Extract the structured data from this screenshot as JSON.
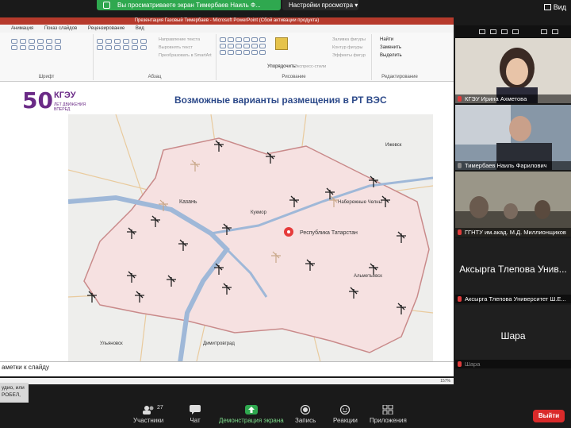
{
  "zoom": {
    "share_banner": "Вы просматриваете экран Тимербаев Наиль Ф...",
    "view_settings": "Настройки просмотра",
    "view_button": "Вид"
  },
  "ppt": {
    "window_title": "Презентация Газовый Тимербаев  -  Microsoft PowerPoint (Сбой активации продукта)",
    "tabs": [
      "Анимация",
      "Показ слайдов",
      "Рецензирование",
      "Вид"
    ],
    "ribbon": {
      "group_font": "Шрифт",
      "group_paragraph": "Абзац",
      "group_drawing": "Рисование",
      "group_editing": "Редактирование",
      "text_direction": "Направление текста",
      "align_text": "Выровнять текст",
      "smartart": "Преобразовать в SmartArt",
      "arrange": "Упорядочить",
      "quick_styles": "Экспресс-стили",
      "shape_fill": "Заливка фигуры",
      "shape_outline": "Контур фигуры",
      "shape_effects": "Эффекты фигур",
      "find": "Найти",
      "replace": "Заменить",
      "select": "Выделить"
    },
    "slide": {
      "logo_number": "50",
      "logo_name": "КГЭУ",
      "logo_sub": "ЛЕТ ДВИЖЕНИЯ ВПЕРЕД",
      "title": "Возможные варианты размещения в РТ ВЭС",
      "map_center_label": "Республика Татарстан",
      "city_kazan": "Казань",
      "city_nab_chelny": "Набережные Челны",
      "city_almetyevsk": "Альметьевск",
      "city_dimitrovgrad": "Димитровград",
      "city_ulyanovsk": "Ульяновск",
      "city_kukmor": "Кукмор",
      "city_izhevsk": "Ижевск"
    },
    "notes_placeholder": "аметки к слайду",
    "zoom_level": "157%"
  },
  "tooltip_text": "удио, или РОБЕЛ,",
  "participants": [
    {
      "name": "КГЭУ Ирина Ахметова"
    },
    {
      "name": "Тимербаев Наиль Фарилович"
    },
    {
      "name": "ГГНТУ им.акад. М.Д. Миллионщиков"
    },
    {
      "name": "Аксырга Тлепова Университет Ш.Е...",
      "big": "Аксырга Тлепова Унив..."
    },
    {
      "name": "Шара",
      "big": "Шара"
    }
  ],
  "toolbar": {
    "participants_label": "Участники",
    "participants_count": "27",
    "chat_label": "Чат",
    "share_label": "Демонстрация экрана",
    "record_label": "Запись",
    "reactions_label": "Реакции",
    "apps_label": "Приложения",
    "leave_label": "Выйти"
  },
  "colors": {
    "share_green": "#2fa84f",
    "leave_red": "#d92a2a",
    "title_blue": "#2d4a8a",
    "brand_purple": "#6a2a86"
  }
}
